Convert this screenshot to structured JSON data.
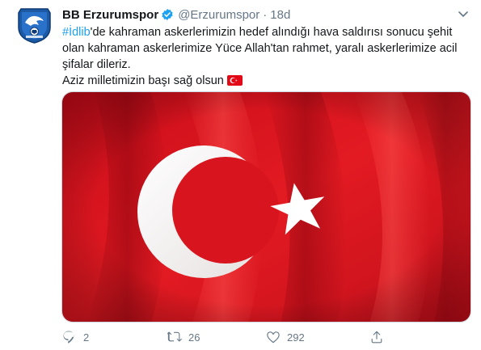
{
  "account": {
    "display_name": "BB Erzurumspor",
    "handle": "@Erzurumspor",
    "separator": "·",
    "time": "18d",
    "avatar_icon": "club-crest-icon",
    "verified_icon": "verified-badge-icon"
  },
  "tweet": {
    "hashtag": "#İdlib",
    "line1_rest": "'de kahraman askerlerimizin hedef alındığı hava saldırısı sonucu şehit",
    "line2": "olan kahraman askerlerimize Yüce Allah'tan rahmet, yaralı askerlerimize acil",
    "line3": "şifalar dileriz.",
    "line4": "Aziz milletimizin başı sağ olsun",
    "emoji": "turkey-flag-emoji"
  },
  "media": {
    "image": "turkish-flag-image"
  },
  "actions": {
    "reply_count": "2",
    "retweet_count": "26",
    "like_count": "292"
  },
  "colors": {
    "accent": "#1da1f2",
    "text_primary": "#14171a",
    "text_secondary": "#657786",
    "flag_red": "#e30a17"
  }
}
